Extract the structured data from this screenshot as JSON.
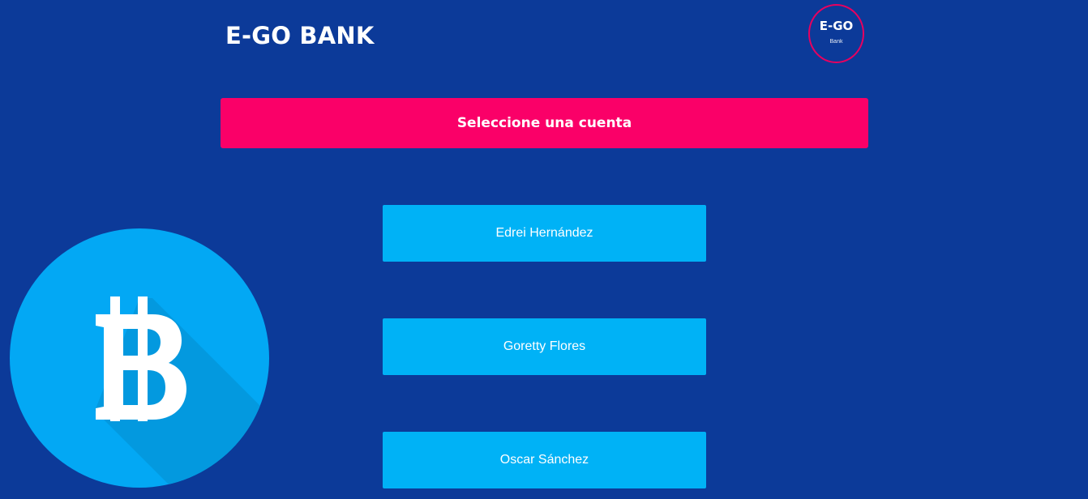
{
  "header": {
    "title": "E-GO BANK",
    "logo": {
      "main": "E-GO",
      "sub": "Bank"
    }
  },
  "banner": {
    "label": "Seleccione una cuenta"
  },
  "accounts": [
    {
      "label": "Edrei Hernández"
    },
    {
      "label": "Goretty Flores"
    },
    {
      "label": "Oscar Sánchez"
    }
  ],
  "decor": {
    "icon": "bitcoin-icon"
  },
  "colors": {
    "background": "#0c3a99",
    "banner": "#fa0068",
    "account_button": "#00b2f6",
    "logo_ring": "#e8005f",
    "bitcoin_circle": "#03a8f4",
    "bitcoin_shadow": "#0399df"
  }
}
